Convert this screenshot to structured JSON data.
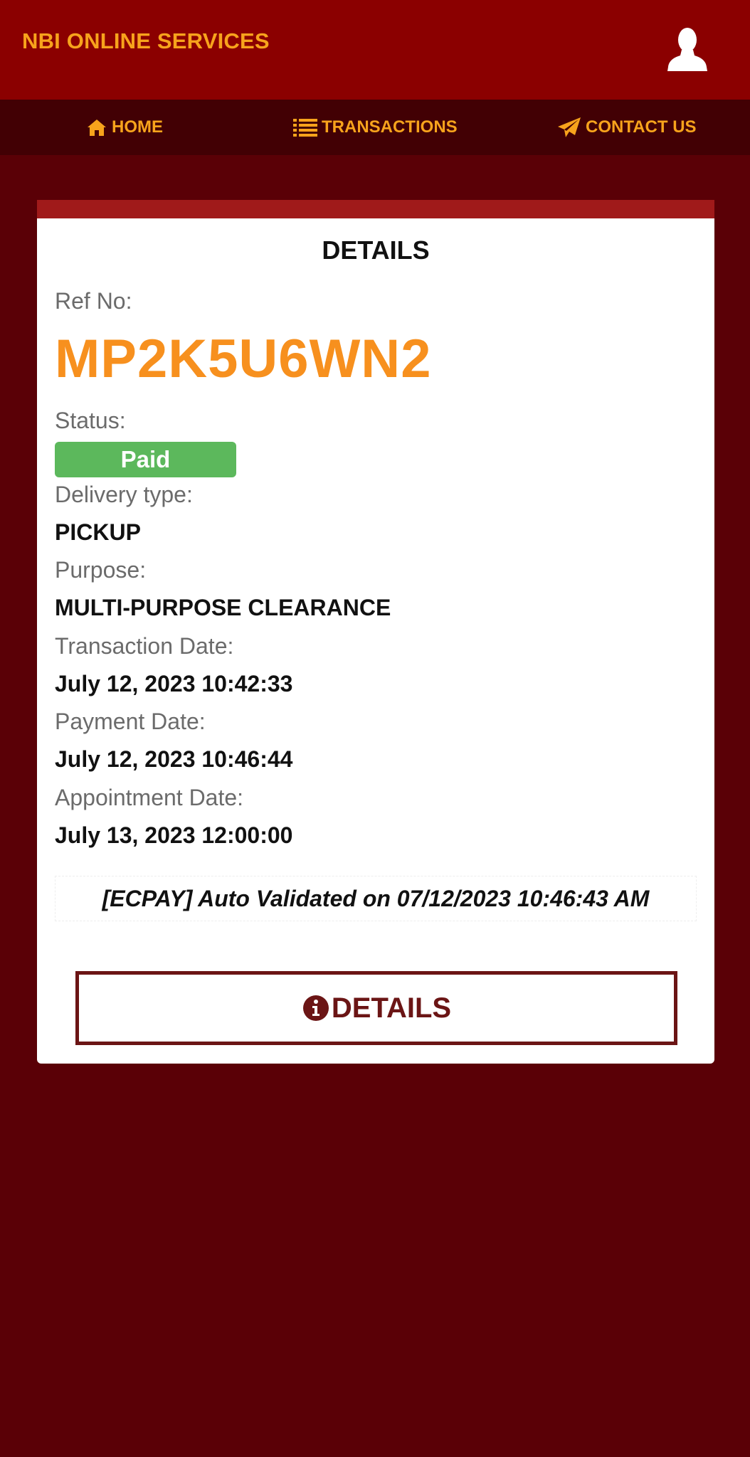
{
  "header": {
    "title": "NBI ONLINE SERVICES",
    "avatar_icon": "user-silhouette-icon"
  },
  "nav": {
    "home_label": "HOME",
    "transactions_label": "TRANSACTIONS",
    "contact_label": "CONTACT US"
  },
  "card": {
    "title": "DETAILS",
    "ref_label": "Ref No:",
    "ref_value": "MP2K5U6WN2",
    "status_label": "Status:",
    "status_value": "Paid",
    "delivery_label": "Delivery type:",
    "delivery_value": "PICKUP",
    "purpose_label": "Purpose:",
    "purpose_value": "MULTI-PURPOSE CLEARANCE",
    "transaction_date_label": "Transaction Date:",
    "transaction_date_value": "July 12, 2023 10:42:33",
    "payment_date_label": "Payment Date:",
    "payment_date_value": "July 12, 2023 10:46:44",
    "appointment_date_label": "Appointment Date:",
    "appointment_date_value": "July 13, 2023 12:00:00",
    "validation_note": "[ECPAY] Auto Validated on 07/12/2023 10:46:43 AM",
    "details_button_label": "DETAILS"
  },
  "colors": {
    "header_bg": "#8b0000",
    "nav_bg": "#420004",
    "page_bg": "#5a0006",
    "accent_orange": "#f7a31c",
    "ref_orange": "#f7901e",
    "paid_green": "#5cb85c",
    "button_maroon": "#6b1515"
  }
}
